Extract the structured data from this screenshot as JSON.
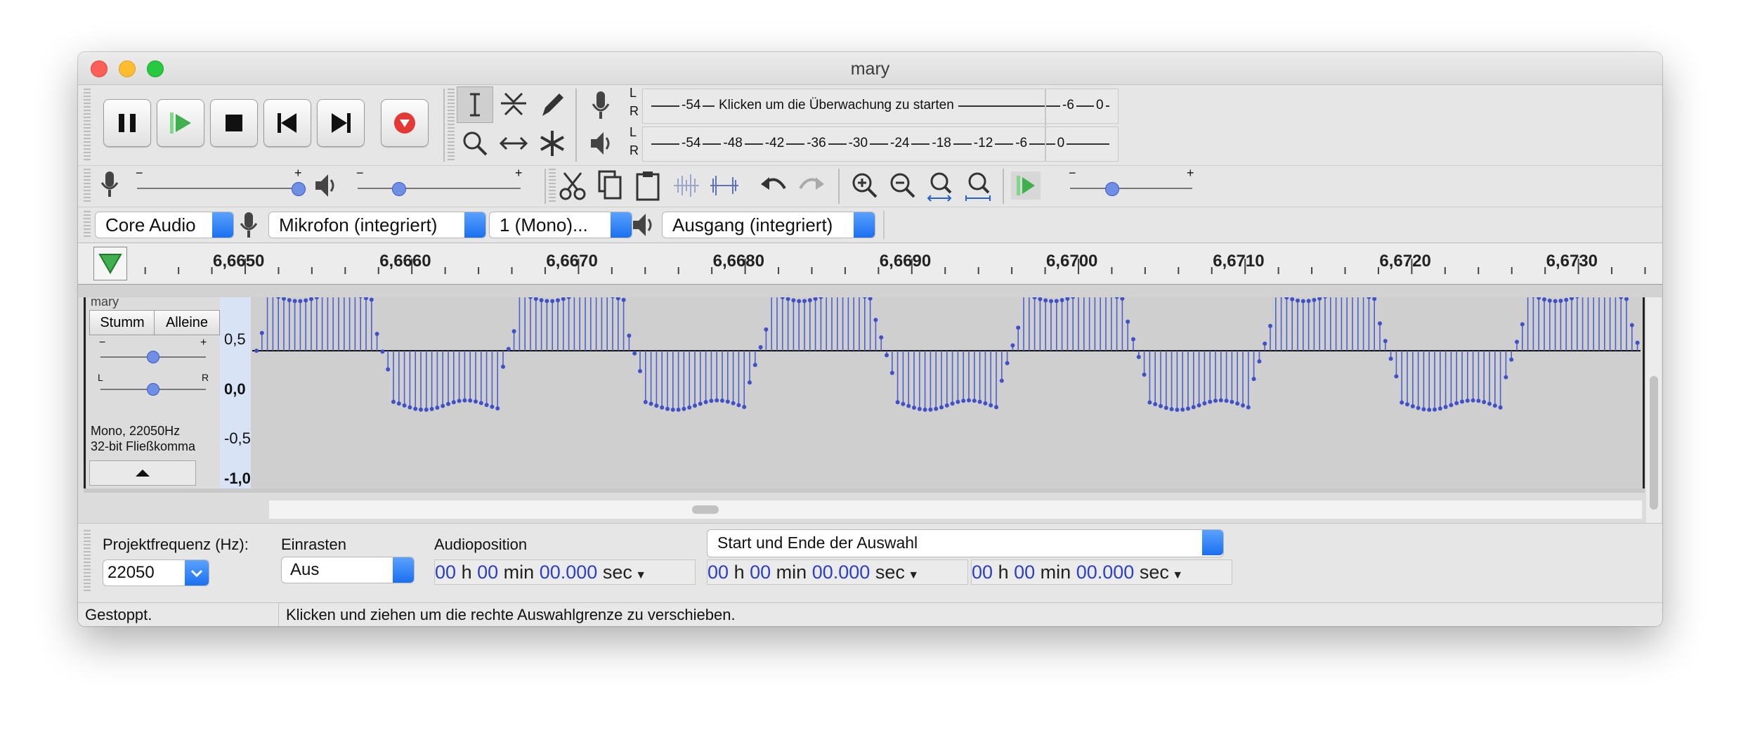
{
  "window": {
    "title": "mary"
  },
  "transport": {
    "buttons": [
      "pause-button",
      "play-button",
      "stop-button",
      "skip-start-button",
      "skip-end-button",
      "record-button"
    ]
  },
  "meters": {
    "record": {
      "channels": [
        "L",
        "R"
      ],
      "ticks": [
        "-54",
        "-6",
        "0"
      ],
      "prompt": "Klicken um die Überwachung zu starten"
    },
    "playback": {
      "channels": [
        "L",
        "R"
      ],
      "ticks": [
        "-54",
        "-48",
        "-42",
        "-36",
        "-30",
        "-24",
        "-18",
        "-12",
        "-6",
        "0"
      ]
    }
  },
  "mixer": {
    "minus": "−",
    "plus": "+"
  },
  "devices": {
    "host": "Core Audio",
    "input": "Mikrofon (integriert)",
    "channels": "1 (Mono)...",
    "output": "Ausgang (integriert)"
  },
  "timeline": {
    "ticks": [
      "6,6650",
      "6,6660",
      "6,6670",
      "6,6680",
      "6,6690",
      "6,6700",
      "6,6710",
      "6,6720",
      "6,6730"
    ]
  },
  "track": {
    "name": "mary",
    "mute_label": "Stumm",
    "solo_label": "Alleine",
    "gain_minus": "−",
    "gain_plus": "+",
    "pan_left": "L",
    "pan_right": "R",
    "info_rate": "Mono, 22050Hz",
    "info_format": "32-bit Fließkomma",
    "scale": [
      "0,5",
      "0,0",
      "-0,5",
      "-1,0"
    ],
    "waveform": {
      "period_samples": 45.9,
      "amplitude": 0.6
    }
  },
  "bottom": {
    "project_rate_label": "Projektfrequenz (Hz):",
    "project_rate_value": "22050",
    "snap_label": "Einrasten",
    "snap_value": "Aus",
    "audio_position_label": "Audioposition",
    "selection_mode": "Start und Ende der Auswahl",
    "time": {
      "h": "00",
      "h_unit": "h",
      "m": "00",
      "m_unit": "min",
      "s": "00.000",
      "s_unit": "sec"
    }
  },
  "status": {
    "state": "Gestoppt.",
    "hint": "Klicken und ziehen um die rechte Auswahlgrenze zu verschieben."
  }
}
